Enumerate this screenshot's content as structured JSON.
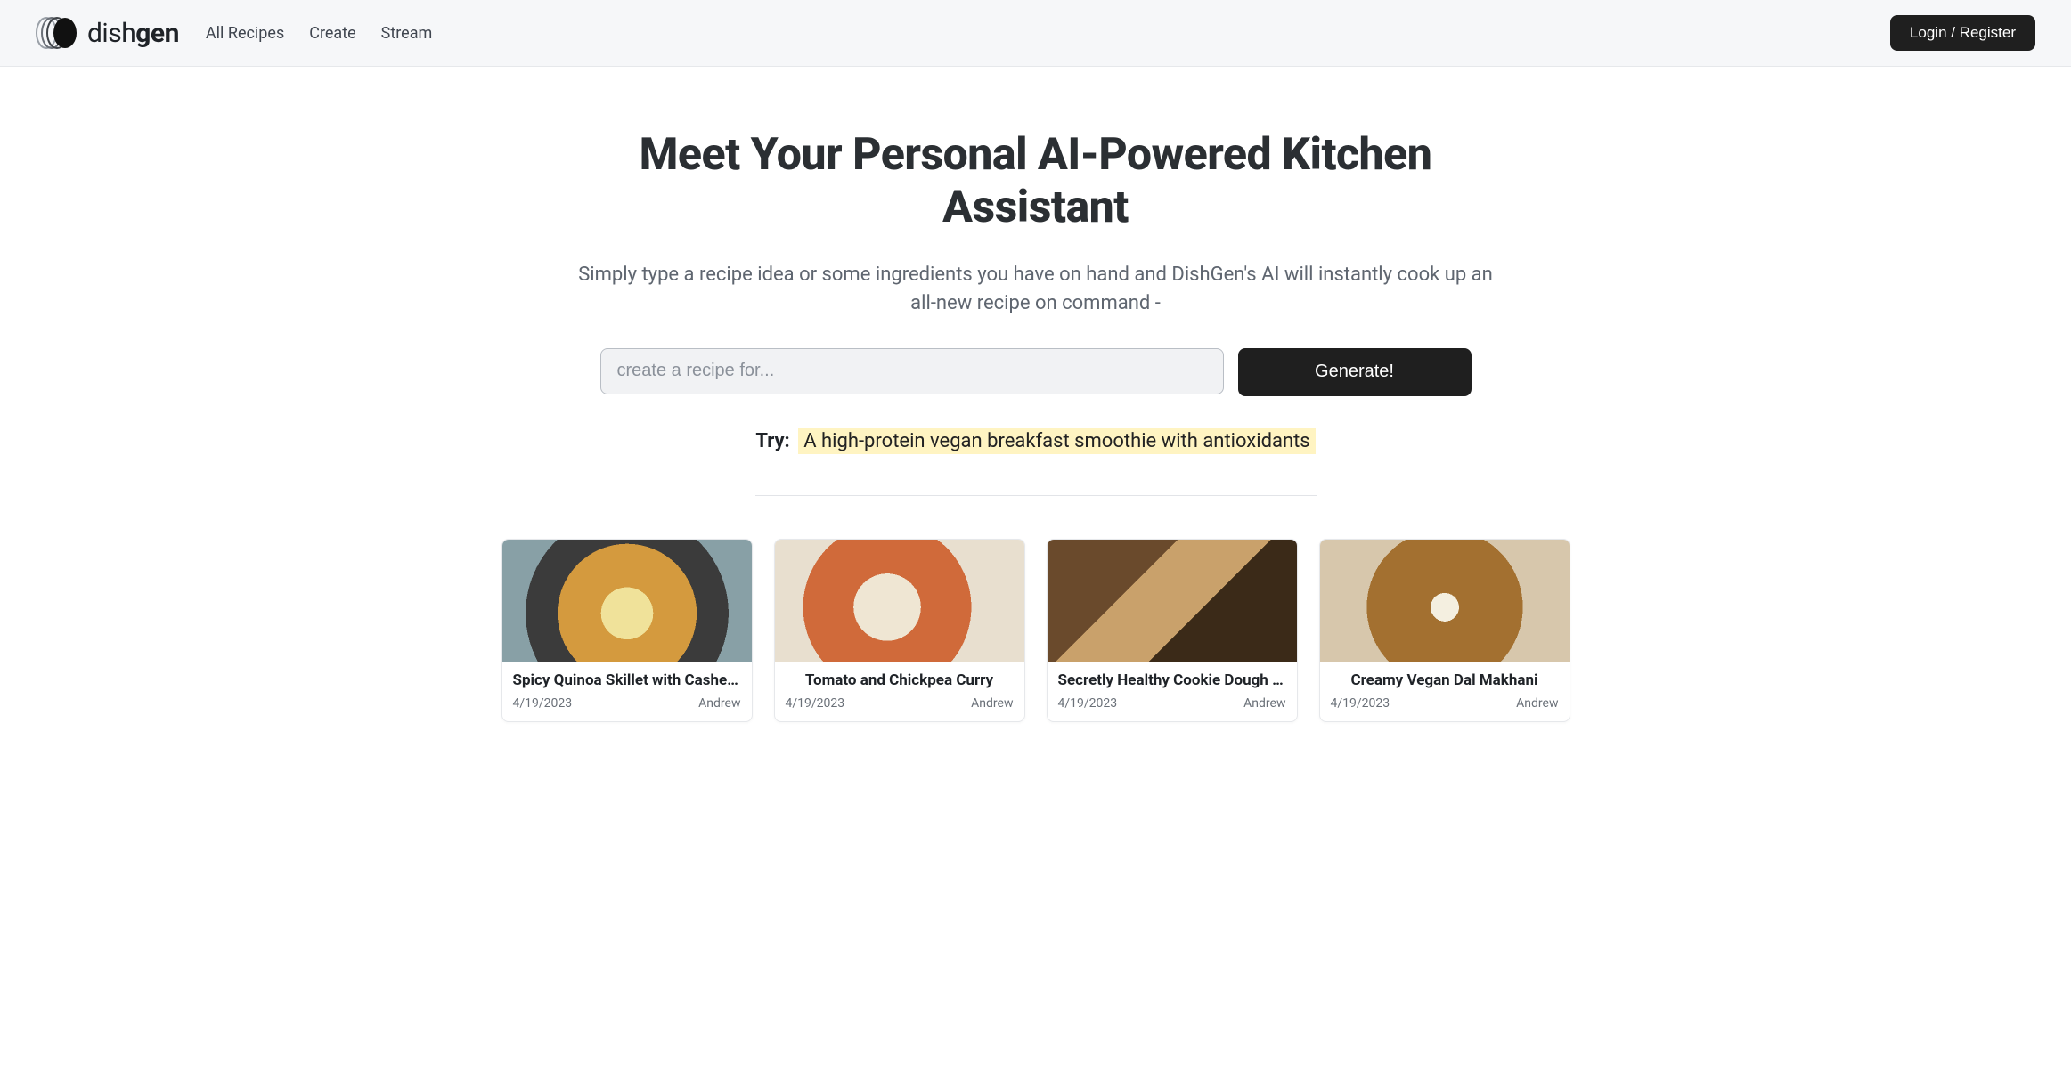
{
  "brand": {
    "name_light": "dish",
    "name_bold": "gen"
  },
  "nav": {
    "items": [
      {
        "label": "All Recipes"
      },
      {
        "label": "Create"
      },
      {
        "label": "Stream"
      }
    ],
    "login_label": "Login / Register"
  },
  "hero": {
    "title": "Meet Your Personal AI-Powered Kitchen Assistant",
    "subtitle": "Simply type a recipe idea or some ingredients you have on hand and DishGen's AI will instantly cook up an all-new recipe on command -",
    "input_placeholder": "create a recipe for...",
    "input_value": "",
    "generate_label": "Generate!",
    "try_label": "Try:",
    "try_example": "A high-protein vegan breakfast smoothie with antioxidants"
  },
  "cards": [
    {
      "title": "Spicy Quinoa Skillet with Cashew Cr…",
      "date": "4/19/2023",
      "author": "Andrew"
    },
    {
      "title": "Tomato and Chickpea Curry",
      "date": "4/19/2023",
      "author": "Andrew"
    },
    {
      "title": "Secretly Healthy Cookie Dough Bars",
      "date": "4/19/2023",
      "author": "Andrew"
    },
    {
      "title": "Creamy Vegan Dal Makhani",
      "date": "4/19/2023",
      "author": "Andrew"
    }
  ]
}
